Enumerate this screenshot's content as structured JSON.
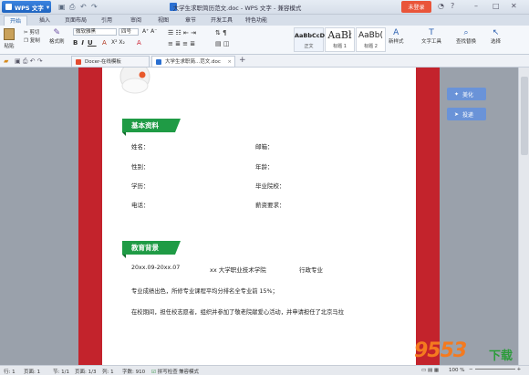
{
  "app": {
    "name": "WPS 文字",
    "window_title": "大学生求职简历范文.doc - WPS 文字 - 兼容模式",
    "login_label": "未登录"
  },
  "menu_tabs": [
    "开始",
    "插入",
    "页面布局",
    "引用",
    "审阅",
    "视图",
    "章节",
    "开发工具",
    "特色功能"
  ],
  "ribbon": {
    "paste": "粘贴",
    "cut": "剪切",
    "copy": "复制",
    "format_painter": "格式刷",
    "font_name": "微软雅黑",
    "font_size": "四号",
    "styles": [
      {
        "preview": "AaBbCcDd",
        "label": "正文"
      },
      {
        "preview": "AaBł",
        "label": "标题 1"
      },
      {
        "preview": "AaBb(",
        "label": "标题 2"
      }
    ],
    "new_style": "新样式",
    "text_tools": "文字工具",
    "find_replace": "查找替换",
    "select": "选择"
  },
  "doc_tabs": [
    {
      "label": "Docer-在线模板",
      "active": false
    },
    {
      "label": "大学生求职简...范文.doc",
      "active": true
    }
  ],
  "sidebar_buttons": {
    "beautify": "美化",
    "submit": "投递"
  },
  "document": {
    "section1_title": "基本资料",
    "fields_left": [
      "姓名：",
      "性别：",
      "学历：",
      "电话："
    ],
    "fields_right": [
      "邮箱：",
      "年龄：",
      "毕业院校：",
      "薪资要求："
    ],
    "section2_title": "教育背景",
    "edu_period": "20xx.09-20xx.07",
    "edu_school": "xx 大学职业技术学院",
    "edu_major": "行政专业",
    "paragraph1": "专业成绩出色，所修专业课程平均分排名全专业前 15%；",
    "paragraph2": "在校期间，担任校志愿者，组织并参加了敬老院献爱心活动，并申请担任了北京马拉"
  },
  "status": {
    "row": "行: 1",
    "page": "页面: 1",
    "section": "节: 1/1",
    "page_count": "页面: 1/3",
    "column": "列: 1",
    "word_count": "字数: 910",
    "spell_check": "拼写检查",
    "compat": "兼容模式",
    "zoom": "100 %"
  },
  "watermark": {
    "number": "9553",
    "suffix": "下载"
  }
}
